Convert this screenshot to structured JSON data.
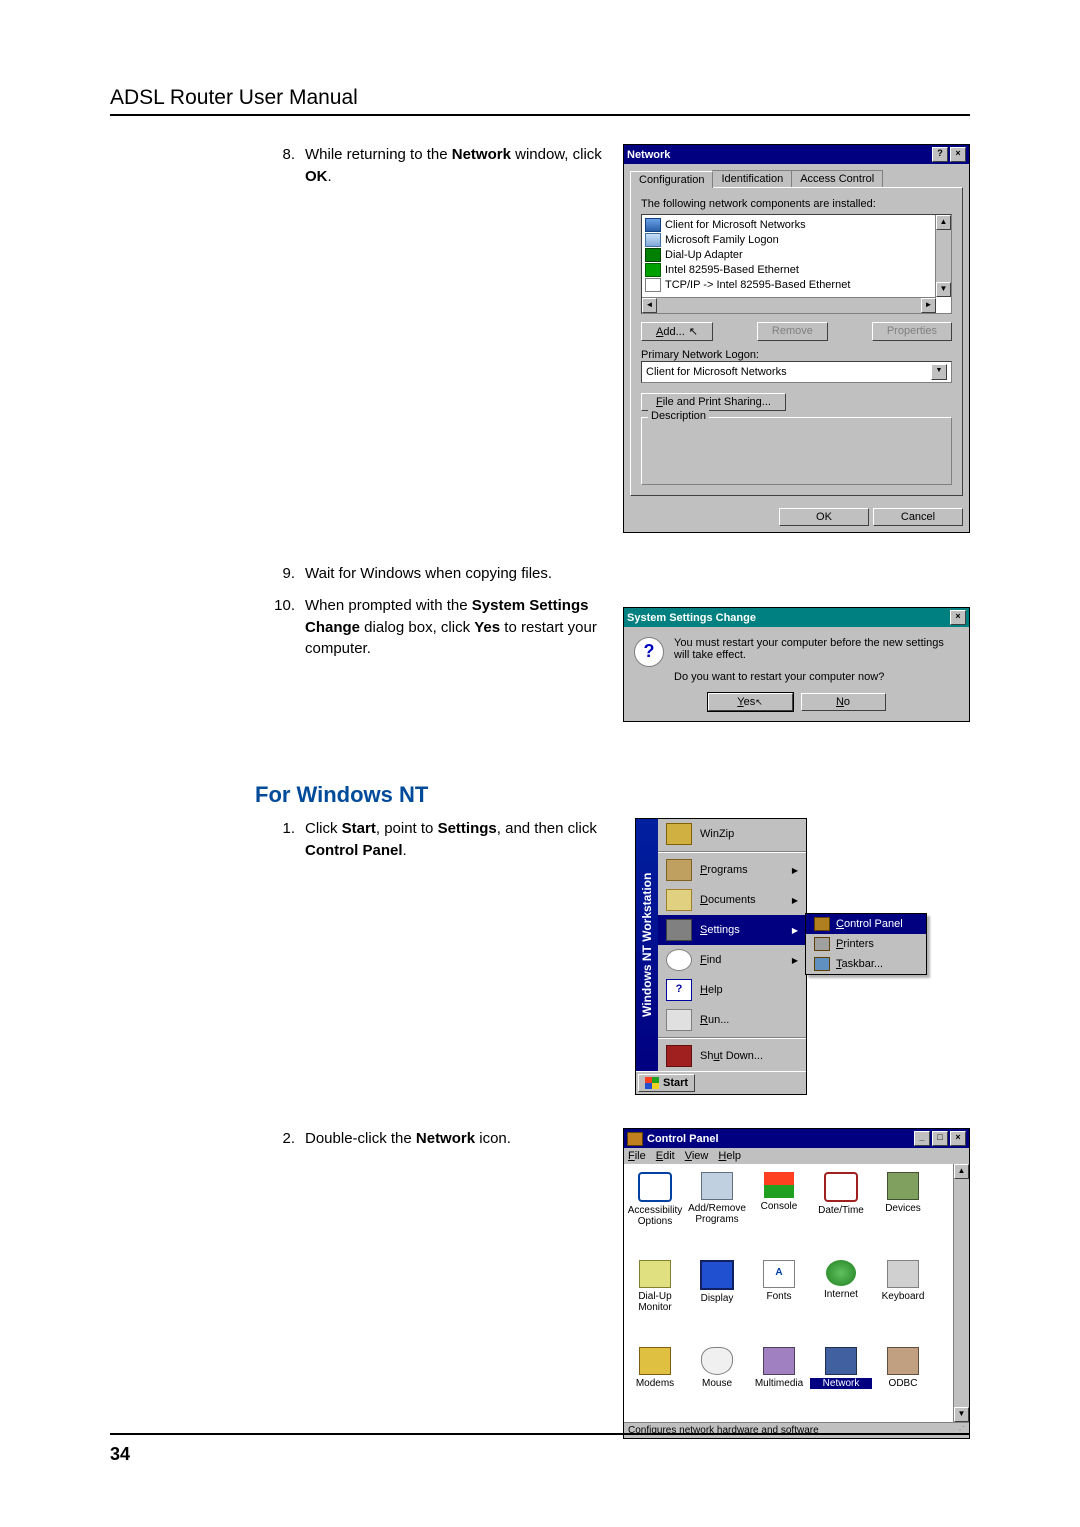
{
  "header": "ADSL Router User Manual",
  "page_number": "34",
  "steps8to10": [
    {
      "num": "8.",
      "pre": "While returning to the ",
      "b1": "Network",
      "mid": " window, click ",
      "b2": "OK",
      "post": "."
    }
  ],
  "steps9to10": [
    {
      "num": "9.",
      "text": "Wait for Windows when copying files."
    },
    {
      "num": "10.",
      "pre": "When prompted with the ",
      "b1": "System Settings Change",
      "mid": " dialog box, click ",
      "b2": "Yes",
      "post": " to restart your computer."
    }
  ],
  "section_nt": "For Windows NT",
  "steps_nt": [
    {
      "num": "1.",
      "pre": "Click ",
      "b1": "Start",
      "mid1": ", point to ",
      "b2": "Settings",
      "mid2": ", and then click ",
      "b3": "Control Panel",
      "post": "."
    },
    {
      "num": "2.",
      "pre": "Double-click the ",
      "b1": "Network",
      "post": " icon."
    }
  ],
  "network_dialog": {
    "title": "Network",
    "tabs": [
      "Configuration",
      "Identification",
      "Access Control"
    ],
    "installed_label": "The following network components are installed:",
    "components": [
      "Client for Microsoft Networks",
      "Microsoft Family Logon",
      "Dial-Up Adapter",
      "Intel 82595-Based Ethernet",
      "TCP/IP -> Intel 82595-Based Ethernet"
    ],
    "add_btn": "Add...",
    "remove_btn": "Remove",
    "properties_btn": "Properties",
    "primary_label": "Primary Network Logon:",
    "primary_value": "Client for Microsoft Networks",
    "fps_btn": "File and Print Sharing...",
    "desc_label": "Description",
    "ok": "OK",
    "cancel": "Cancel"
  },
  "settings_change": {
    "title": "System Settings Change",
    "line1": "You must restart your computer before the new settings will take effect.",
    "line2": "Do you want to restart your computer now?",
    "yes": "Yes",
    "no": "No"
  },
  "start_menu": {
    "band": "Windows NT Workstation",
    "items": [
      {
        "label": "WinZip"
      },
      {
        "label": "Programs",
        "arrow": true
      },
      {
        "label": "Documents",
        "arrow": true
      },
      {
        "label": "Settings",
        "arrow": true,
        "selected": true
      },
      {
        "label": "Find",
        "arrow": true
      },
      {
        "label": "Help"
      },
      {
        "label": "Run..."
      },
      {
        "sep": true
      },
      {
        "label": "Shut Down..."
      }
    ],
    "submenu": [
      {
        "label": "Control Panel",
        "selected": true
      },
      {
        "label": "Printers"
      },
      {
        "label": "Taskbar..."
      }
    ],
    "start": "Start"
  },
  "control_panel": {
    "title": "Control Panel",
    "menus": [
      "File",
      "Edit",
      "View",
      "Help"
    ],
    "icons": [
      "Accessibility Options",
      "Add/Remove Programs",
      "Console",
      "Date/Time",
      "Devices",
      "Dial-Up Monitor",
      "Display",
      "Fonts",
      "Internet",
      "Keyboard",
      "Modems",
      "Mouse",
      "Multimedia",
      "Network",
      "ODBC"
    ],
    "selected": "Network",
    "status": "Configures network hardware and software"
  }
}
